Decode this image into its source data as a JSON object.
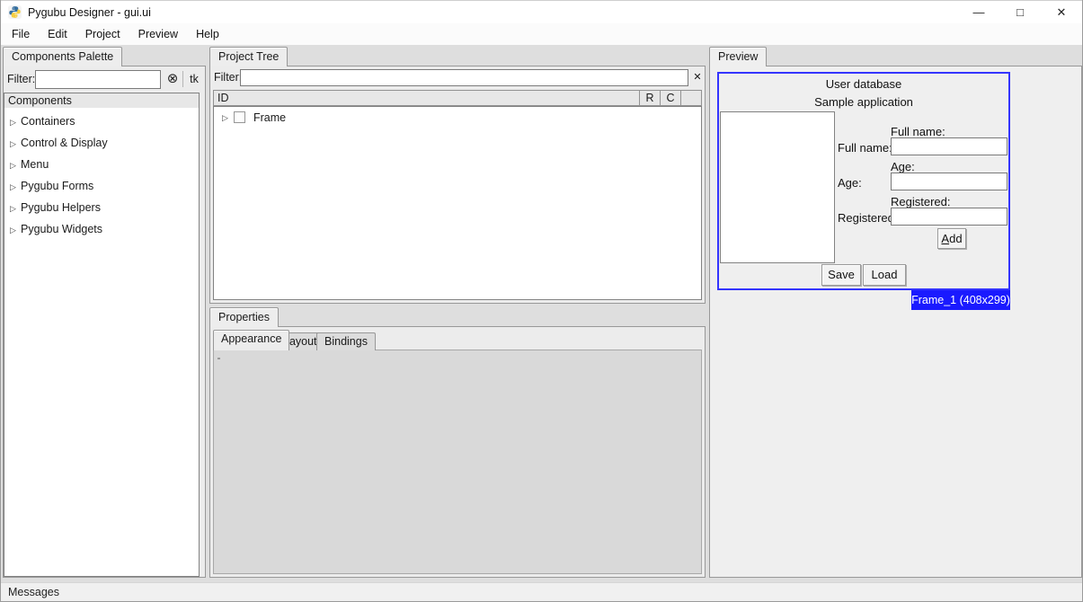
{
  "window": {
    "title": "Pygubu Designer - gui.ui"
  },
  "window_controls": {
    "minimize": "—",
    "maximize": "□",
    "close": "✕"
  },
  "menubar": {
    "items": [
      "File",
      "Edit",
      "Project",
      "Preview",
      "Help"
    ]
  },
  "icons": {
    "expander": "▷",
    "clear_circle": "⊗",
    "clear_x": "✕"
  },
  "palette": {
    "tab_label": "Components Palette",
    "filter_label": "Filter:",
    "filter_value": "",
    "tk_button": "tk",
    "list_header": "Components",
    "items": [
      "Containers",
      "Control & Display",
      "Menu",
      "Pygubu Forms",
      "Pygubu Helpers",
      "Pygubu Widgets"
    ]
  },
  "project_tree": {
    "tab_label": "Project Tree",
    "filter_label": "Filter:",
    "filter_value": "",
    "columns": [
      "ID",
      "R",
      "C"
    ],
    "rows": [
      {
        "id": "Frame"
      }
    ]
  },
  "properties": {
    "tab_label": "Properties",
    "subtabs": [
      "Appearance",
      "Layout",
      "Bindings"
    ],
    "active_subtab": "Appearance"
  },
  "preview": {
    "tab_label": "Preview",
    "badge": "Frame_1 (408x299)",
    "app": {
      "title1": "User database",
      "title2": "Sample application",
      "fields": [
        {
          "label": "Full name:",
          "header": "Full name:",
          "value": ""
        },
        {
          "label": "Age:",
          "header": "Age:",
          "value": ""
        },
        {
          "label": "Registered:",
          "header": "Registered:",
          "value": ""
        }
      ],
      "add": "Add",
      "save": "Save",
      "load": "Load"
    }
  },
  "statusbar": {
    "text": "Messages"
  },
  "colors": {
    "badge_bg": "#1a1aff",
    "preview_border": "#3434ff",
    "content_bg": "#d9d9d9"
  }
}
